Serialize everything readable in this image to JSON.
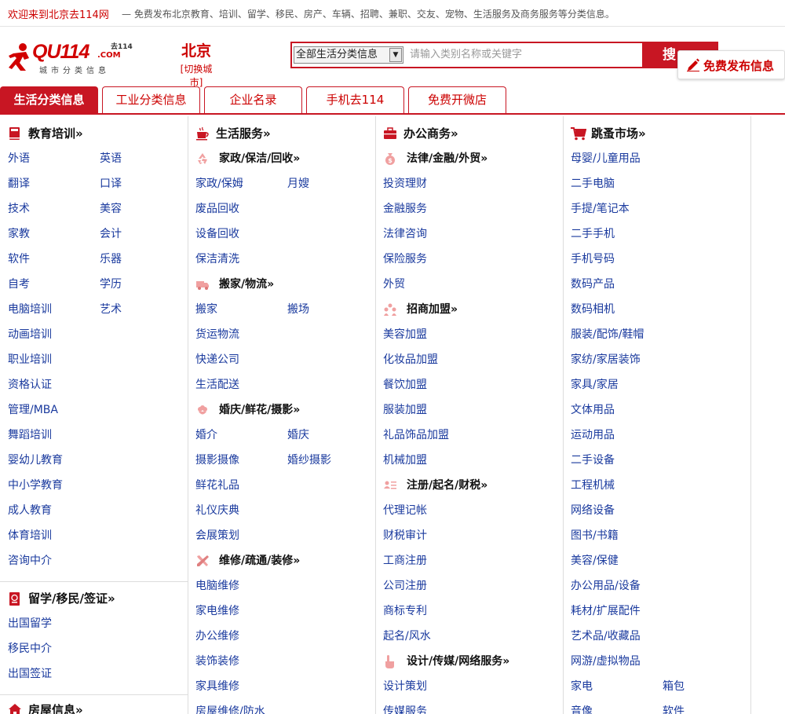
{
  "topbar": {
    "welcome": "欢迎来到北京去114网",
    "desc": "— 免费发布北京教育、培训、留学、移民、房产、车辆、招聘、兼职、交友、宠物、生活服务及商务服务等分类信息。"
  },
  "logo": {
    "main": "QU114",
    "sup": "去114",
    "com": ".COM",
    "sub": "城市分类信息"
  },
  "city": {
    "name": "北京",
    "switch": "[切换城市]"
  },
  "search": {
    "select_value": "全部生活分类信息",
    "placeholder": "请输入类别名称或关键字",
    "button": "搜"
  },
  "publish": {
    "label": "免费发布信息"
  },
  "tabs": [
    "生活分类信息",
    "工业分类信息",
    "企业名录",
    "手机去114",
    "免费开微店"
  ],
  "colors": {
    "brand_red": "#c81623",
    "link_blue": "#1a3a9e"
  },
  "columns": {
    "edu": {
      "title": "教育培训",
      "links": [
        "外语",
        "英语",
        "翻译",
        "口译",
        "技术",
        "美容",
        "家教",
        "会计",
        "软件",
        "乐器",
        "自考",
        "学历",
        "电脑培训",
        "艺术",
        "动画培训",
        "职业培训",
        "资格认证",
        "管理/MBA",
        "舞蹈培训",
        "婴幼儿教育",
        "中小学教育",
        "成人教育",
        "体育培训",
        "咨询中介"
      ]
    },
    "abroad": {
      "title": "留学/移民/签证",
      "links": [
        "出国留学",
        "移民中介",
        "出国签证"
      ]
    },
    "house": {
      "title": "房屋信息"
    },
    "life": {
      "title": "生活服务",
      "sub1": {
        "title": "家政/保洁/回收",
        "links": [
          "家政/保姆",
          "月嫂",
          "废品回收",
          "设备回收",
          "保洁清洗"
        ]
      },
      "sub2": {
        "title": "搬家/物流",
        "links": [
          "搬家",
          "搬场",
          "货运物流",
          "快递公司",
          "生活配送"
        ]
      },
      "sub3": {
        "title": "婚庆/鲜花/摄影",
        "links": [
          "婚介",
          "婚庆",
          "摄影摄像",
          "婚纱摄影",
          "鲜花礼品",
          "礼仪庆典",
          "会展策划"
        ]
      },
      "sub4": {
        "title": "维修/疏通/装修",
        "links": [
          "电脑维修",
          "家电维修",
          "办公维修",
          "装饰装修",
          "家具维修",
          "房屋维修/防水"
        ]
      }
    },
    "office": {
      "title": "办公商务",
      "sub1": {
        "title": "法律/金融/外贸",
        "links": [
          "投资理财",
          "金融服务",
          "法律咨询",
          "保险服务",
          "外贸"
        ]
      },
      "sub2": {
        "title": "招商加盟",
        "links": [
          "美容加盟",
          "化妆品加盟",
          "餐饮加盟",
          "服装加盟",
          "礼品饰品加盟",
          "机械加盟"
        ]
      },
      "sub3": {
        "title": "注册/起名/财税",
        "links": [
          "代理记帐",
          "财税审计",
          "工商注册",
          "公司注册",
          "商标专利",
          "起名/风水"
        ]
      },
      "sub4": {
        "title": "设计/传媒/网络服务",
        "links": [
          "设计策划",
          "传媒服务"
        ]
      }
    },
    "market": {
      "title": "跳蚤市场",
      "links": [
        "母婴/儿童用品",
        "二手电脑",
        "手提/笔记本",
        "二手手机",
        "手机号码",
        "数码产品",
        "数码相机",
        "服装/配饰/鞋帽",
        "家纺/家居装饰",
        "家具/家居",
        "文体用品",
        "运动用品",
        "二手设备",
        "工程机械",
        "网络设备",
        "图书/书籍",
        "美容/保健",
        "办公用品/设备",
        "耗材/扩展配件",
        "艺术品/收藏品",
        "网游/虚拟物品",
        "家电",
        "箱包",
        "音像",
        "软件"
      ]
    }
  },
  "more_mark": "»"
}
